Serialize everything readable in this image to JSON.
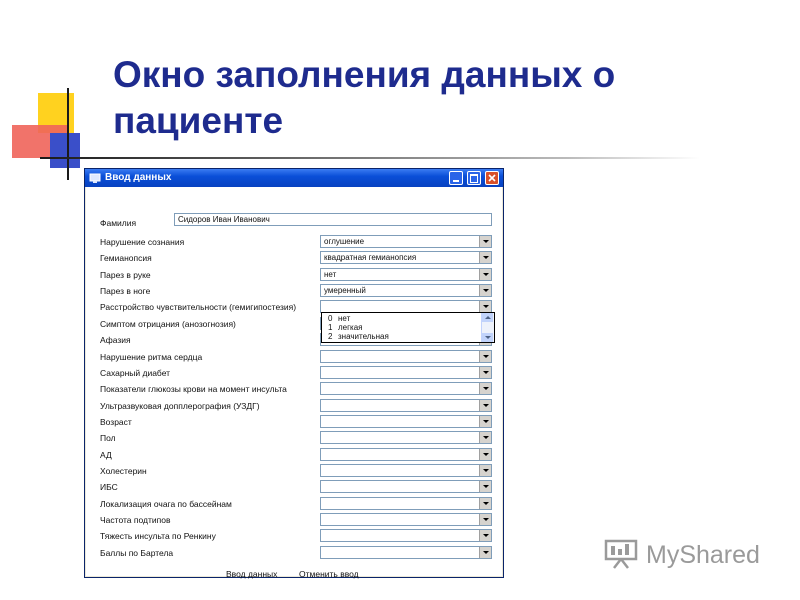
{
  "slide": {
    "title": "Окно заполнения данных о пациенте"
  },
  "window": {
    "title": "Ввод данных",
    "fio": {
      "label": "Фамилия",
      "value": "Сидоров Иван Иванович"
    },
    "fields": [
      {
        "label": "Нарушение сознания",
        "value": "оглушение"
      },
      {
        "label": "Гемианопсия",
        "value": "квадратная гемианопсия"
      },
      {
        "label": "Парез в руке",
        "value": "нет"
      },
      {
        "label": "Парез в ноге",
        "value": "умеренный"
      },
      {
        "label": "Расстройство чувствительности (гемигипостезия)",
        "value": ""
      },
      {
        "label": "Симптом отрицания (анозогнозия)",
        "value": ""
      },
      {
        "label": "Афазия",
        "value": ""
      },
      {
        "label": "Нарушение ритма сердца",
        "value": ""
      },
      {
        "label": "Сахарный диабет",
        "value": ""
      },
      {
        "label": "Показатели глюкозы крови на момент инсульта",
        "value": ""
      },
      {
        "label": "Ультразвуковая допплерография (УЗДГ)",
        "value": ""
      },
      {
        "label": "Возраст",
        "value": ""
      },
      {
        "label": "Пол",
        "value": ""
      },
      {
        "label": "АД",
        "value": ""
      },
      {
        "label": "Холестерин",
        "value": ""
      },
      {
        "label": "ИБС",
        "value": ""
      },
      {
        "label": "Локализация очага по бассейнам",
        "value": ""
      },
      {
        "label": "Частота подтипов",
        "value": ""
      },
      {
        "label": "Тяжесть инсульта по Ренкину",
        "value": ""
      },
      {
        "label": "Баллы по Бартела",
        "value": ""
      }
    ],
    "dropdown_options": [
      {
        "num": "0",
        "text": "нет"
      },
      {
        "num": "1",
        "text": "легкая"
      },
      {
        "num": "2",
        "text": "значительная"
      }
    ],
    "buttons": {
      "submit": "Ввод данных",
      "cancel": "Отменить ввод"
    }
  },
  "watermark": {
    "text": "MyShared"
  },
  "colors": {
    "title": "#1e2b8e",
    "titlebar": "#0a4fd8",
    "window_bg": "#ece9d8"
  }
}
